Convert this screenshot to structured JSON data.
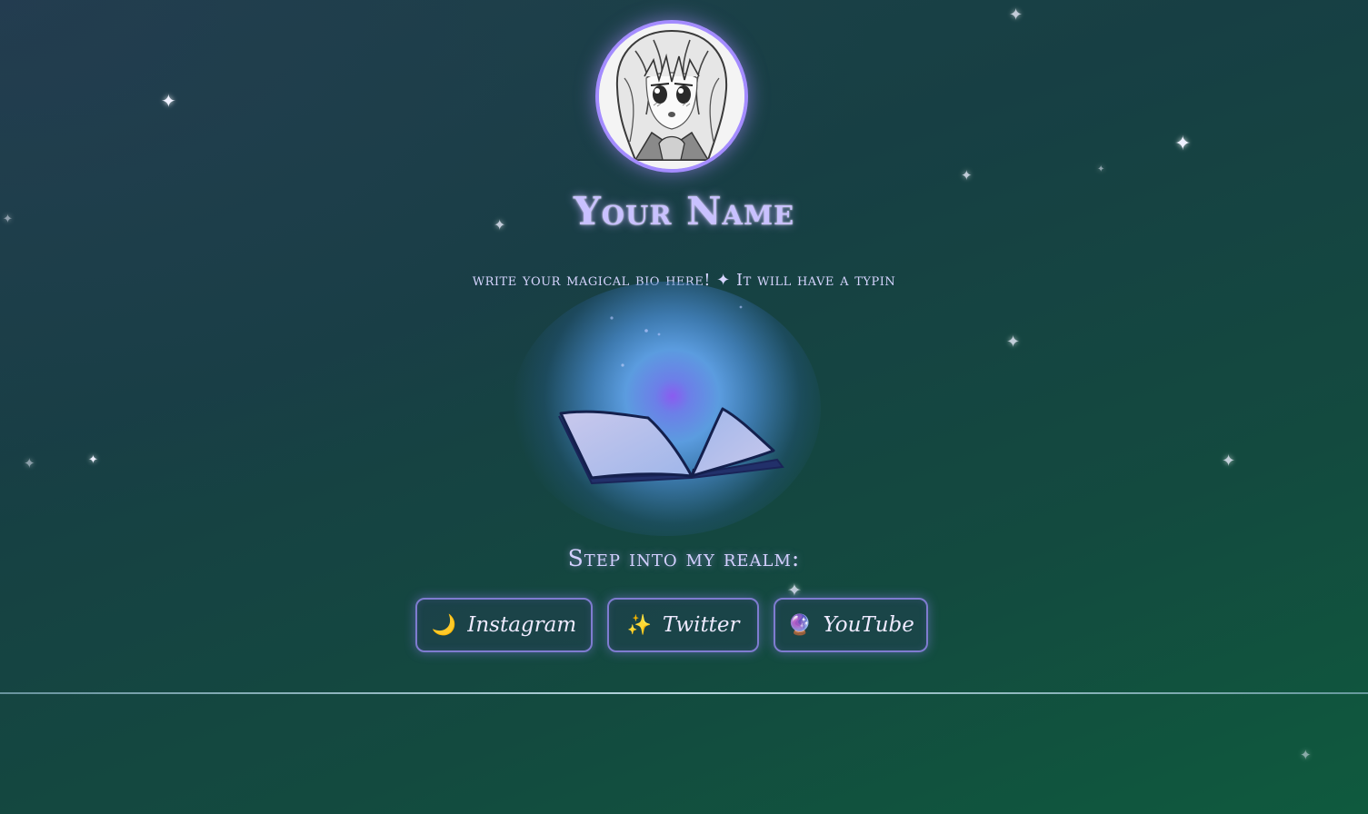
{
  "profile": {
    "name": "Your Name",
    "bio": "write your magical bio here! ✦ It will have a typin",
    "avatar_icon": "anime-girl-avatar"
  },
  "book": {
    "icon": "open-book-icon"
  },
  "realm": {
    "heading": "Step into my realm:"
  },
  "links": [
    {
      "icon": "🌙",
      "icon_name": "moon-icon",
      "label": "Instagram"
    },
    {
      "icon": "✨",
      "icon_name": "sparkles-icon",
      "label": "Twitter"
    },
    {
      "icon": "🔮",
      "icon_name": "crystal-ball-icon",
      "label": "YouTube"
    }
  ],
  "decor": {
    "star_glyph": "✦"
  },
  "colors": {
    "accent": "#a48cff",
    "name_glow": "#c9c1ff",
    "background_start": "#1d4349",
    "background_end": "#0f5a3e"
  }
}
